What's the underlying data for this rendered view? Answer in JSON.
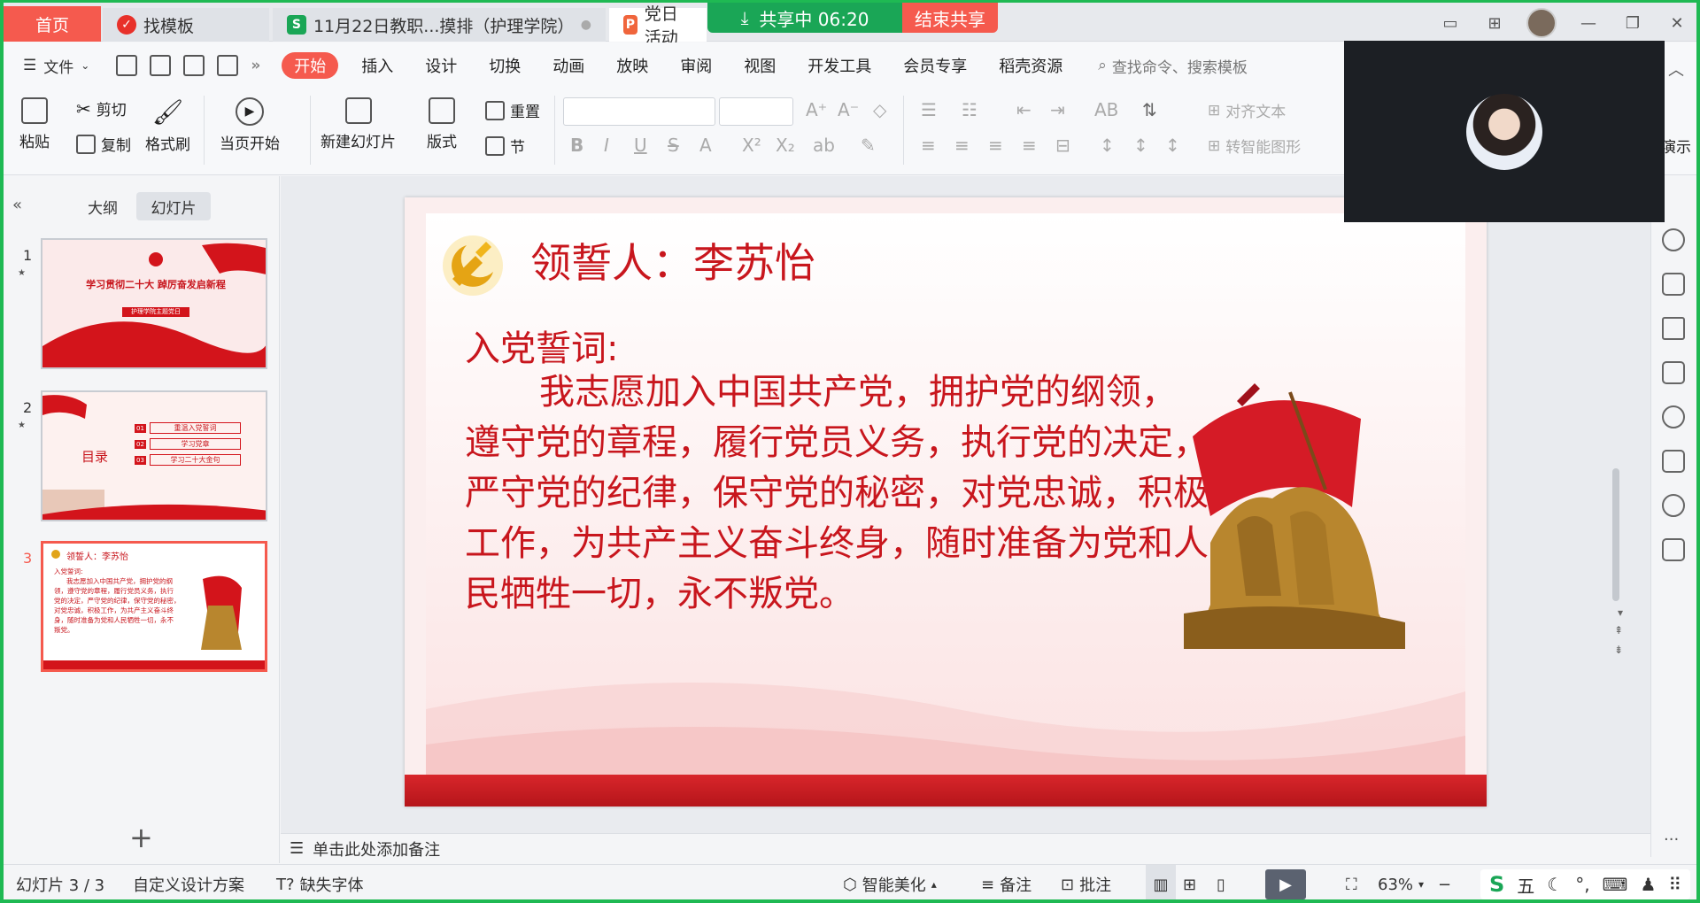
{
  "tabs": {
    "home": "首页",
    "t2": "找模板",
    "t3": "11月22日教职...摸排（护理学院）",
    "t4": "党日活动"
  },
  "share": {
    "status": "共享中 06:20",
    "end": "结束共享"
  },
  "menu": {
    "file": "文件",
    "items": [
      "开始",
      "插入",
      "设计",
      "切换",
      "动画",
      "放映",
      "审阅",
      "视图",
      "开发工具",
      "会员专享",
      "稻壳资源"
    ],
    "search_placeholder": "查找命令、搜索模板"
  },
  "ribbon": {
    "paste": "粘贴",
    "cut": "剪切",
    "copy": "复制",
    "format_painter": "格式刷",
    "start_current": "当页开始",
    "new_slide": "新建幻灯片",
    "layout": "版式",
    "reset": "重置",
    "section": "节",
    "text_align": "对齐文本",
    "smart_art": "转智能图形",
    "presenter": "演示"
  },
  "left_pane": {
    "tab_outline": "大纲",
    "tab_slides": "幻灯片",
    "thumbs": [
      {
        "num": "1",
        "title": "学习贯彻二十大 踔厉奋发启新程",
        "sub": "护理学院主题党日"
      },
      {
        "num": "2",
        "label": "目录",
        "items": [
          "重温入党誓词",
          "学习党章",
          "学习二十大金句"
        ],
        "nums": [
          "01",
          "02",
          "03"
        ]
      },
      {
        "num": "3",
        "title": "领誓人：李苏怡",
        "lines": [
          "入党誓词:",
          "我志愿加入中国共产党，拥护党的纲",
          "领，遵守党的章程，履行党员义务，执行",
          "党的决定，严守党的纪律，保守党的秘密，",
          "对党忠诚，积极工作，为共产主义奋斗终",
          "身，随时准备为党和人民牺牲一切，永不",
          "叛党。"
        ]
      }
    ]
  },
  "slide": {
    "title": "领誓人：李苏怡",
    "heading": "入党誓词:",
    "body": "我志愿加入中国共产党，拥护党的纲领，遵守党的章程，履行党员义务，执行党的决定，严守党的纪律，保守党的秘密，对党忠诚，积极工作，为共产主义奋斗终身，随时准备为党和人民牺牲一切，永不叛党。"
  },
  "notes": "单击此处添加备注",
  "status": {
    "slide_count": "幻灯片 3 / 3",
    "design": "自定义设计方案",
    "missing_font": "缺失字体",
    "beautify": "智能美化",
    "notes": "备注",
    "comment": "批注",
    "zoom": "63%",
    "ime_char": "五"
  },
  "colors": {
    "accent": "#f55a4e",
    "share_green": "#1aa656",
    "slide_red": "#c8161d",
    "frame_green": "#1fb953"
  }
}
